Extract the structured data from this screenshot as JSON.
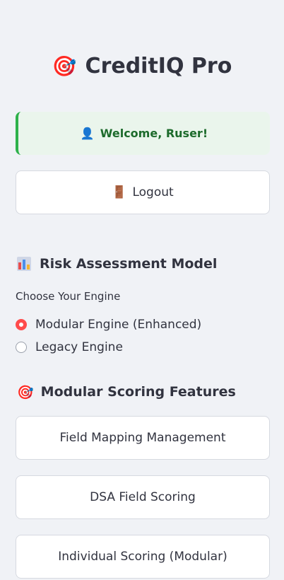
{
  "app": {
    "title": "CreditIQ Pro",
    "icon": "target-icon"
  },
  "welcome": {
    "text": "Welcome, Ruser!",
    "icon": "user-icon"
  },
  "logout": {
    "label": "Logout",
    "icon": "door-icon"
  },
  "risk_section": {
    "heading": "Risk Assessment Model",
    "icon": "bar-chart-icon",
    "radio_label": "Choose Your Engine",
    "options": [
      {
        "label": "Modular Engine (Enhanced)",
        "selected": true
      },
      {
        "label": "Legacy Engine",
        "selected": false
      }
    ],
    "accent": "#ff4b4b"
  },
  "features_section": {
    "heading": "Modular Scoring Features",
    "icon": "target-icon",
    "buttons": [
      "Field Mapping Management",
      "DSA Field Scoring",
      "Individual Scoring (Modular)"
    ]
  }
}
